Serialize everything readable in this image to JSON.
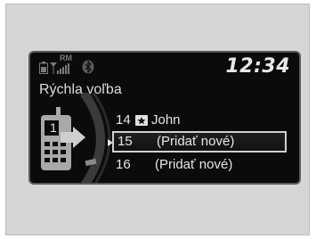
{
  "status": {
    "time": "12:34",
    "icons": [
      "battery-icon",
      "signal-icon",
      "roaming-icon",
      "bluetooth-icon"
    ],
    "roaming_text": "RM"
  },
  "screen": {
    "title": "Rýchla voľba"
  },
  "speed_dial": {
    "items": [
      {
        "number": "14",
        "label": "John",
        "icon": "contact-card-icon",
        "selected": false
      },
      {
        "number": "15",
        "label": "(Pridať nové)",
        "selected": true
      },
      {
        "number": "16",
        "label": "(Pridať nové)",
        "selected": false
      }
    ],
    "phone_slot": "1"
  },
  "colors": {
    "screen_bg": "#0b0b0b",
    "text": "#e6e6e6",
    "selection_border": "#d0d0d0"
  }
}
